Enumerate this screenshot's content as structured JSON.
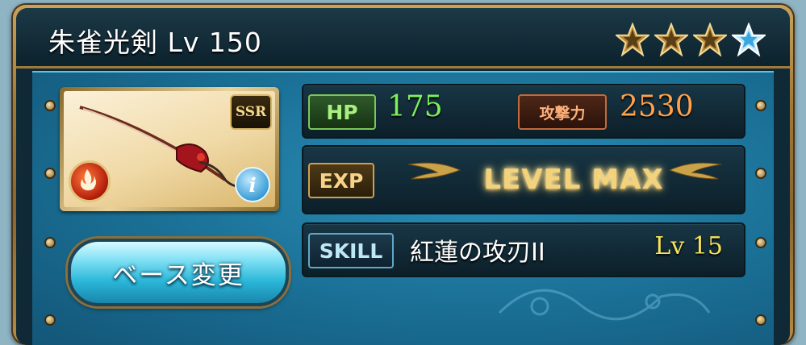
{
  "weapon": {
    "name_level": "朱雀光剣 Lv 150",
    "rarity": "SSR",
    "element": "fire",
    "stars": [
      {
        "type": "gold",
        "icon": "gold-star-icon"
      },
      {
        "type": "gold",
        "icon": "gold-star-icon"
      },
      {
        "type": "gold",
        "icon": "gold-star-icon"
      },
      {
        "type": "blue",
        "icon": "blue-star-icon"
      }
    ]
  },
  "stats": {
    "hp_label": "HP",
    "hp_value": "175",
    "atk_label": "攻撃力",
    "atk_value": "2530",
    "exp_label": "EXP",
    "exp_value": "LEVEL MAX"
  },
  "skill": {
    "label": "SKILL",
    "name": "紅蓮の攻刃II",
    "level": "Lv 15"
  },
  "buttons": {
    "change_base": "ベース変更"
  },
  "colors": {
    "hp": "#7cf05a",
    "atk": "#ffa24c",
    "skill_level": "#f6e25a",
    "panel": "#1a6f95",
    "frame_gold": "#a27a37"
  }
}
